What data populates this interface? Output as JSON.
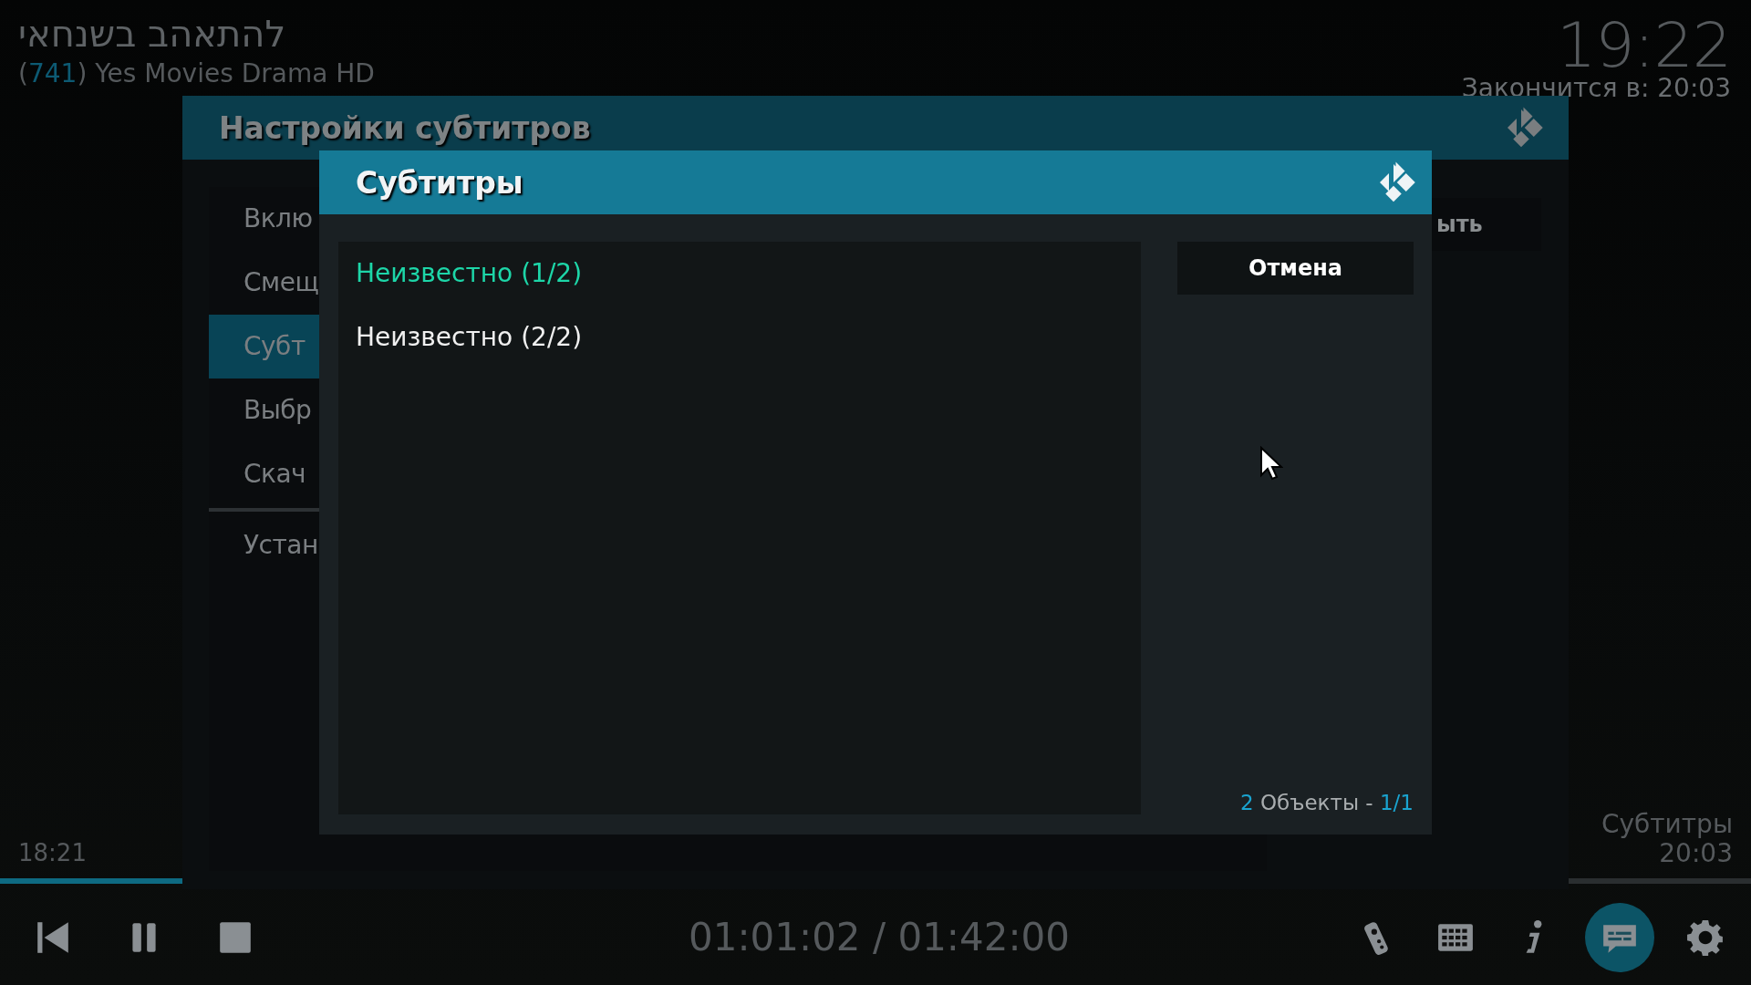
{
  "now_playing": {
    "title": "להתאהב בשנחאי",
    "paren_open": "(",
    "channel_number": "741",
    "paren_close": ")",
    "channel_name": "Yes Movies Drama HD"
  },
  "clock": {
    "time": "19:22",
    "ends_at": "Закончится в: 20:03"
  },
  "settings_dialog": {
    "title": "Настройки субтитров",
    "close_button": "ыть",
    "items": [
      {
        "label": "Вклю",
        "selected": false,
        "divider_before": false
      },
      {
        "label": "Смещ",
        "selected": false,
        "divider_before": false
      },
      {
        "label": "Субт",
        "selected": true,
        "divider_before": false
      },
      {
        "label": "Выбр",
        "selected": false,
        "divider_before": false
      },
      {
        "label": "Скач",
        "selected": false,
        "divider_before": false
      },
      {
        "label": "Устан",
        "selected": false,
        "divider_before": true
      }
    ]
  },
  "subtitles_dialog": {
    "title": "Субтитры",
    "cancel_button": "Отмена",
    "items": [
      {
        "label": "Неизвестно (1/2)",
        "selected": true
      },
      {
        "label": "Неизвестно (2/2)",
        "selected": false
      }
    ],
    "footer": {
      "count": "2",
      "count_label": "Объекты -",
      "page": "1/1"
    }
  },
  "start_time": "18:21",
  "next": {
    "title": "Субтитры",
    "time": "20:03"
  },
  "progress": {
    "level": 0.6
  },
  "controls": {
    "time": "01:01:02 / 01:42:00",
    "buttons": [
      {
        "kind": "previous",
        "active": false
      },
      {
        "kind": "pause",
        "active": false
      },
      {
        "kind": "stop",
        "active": false
      },
      {
        "kind": "remote",
        "active": false
      },
      {
        "kind": "keyboard",
        "active": false
      },
      {
        "kind": "info",
        "active": false
      },
      {
        "kind": "subtitles",
        "active": true
      },
      {
        "kind": "settings",
        "active": false
      }
    ]
  }
}
